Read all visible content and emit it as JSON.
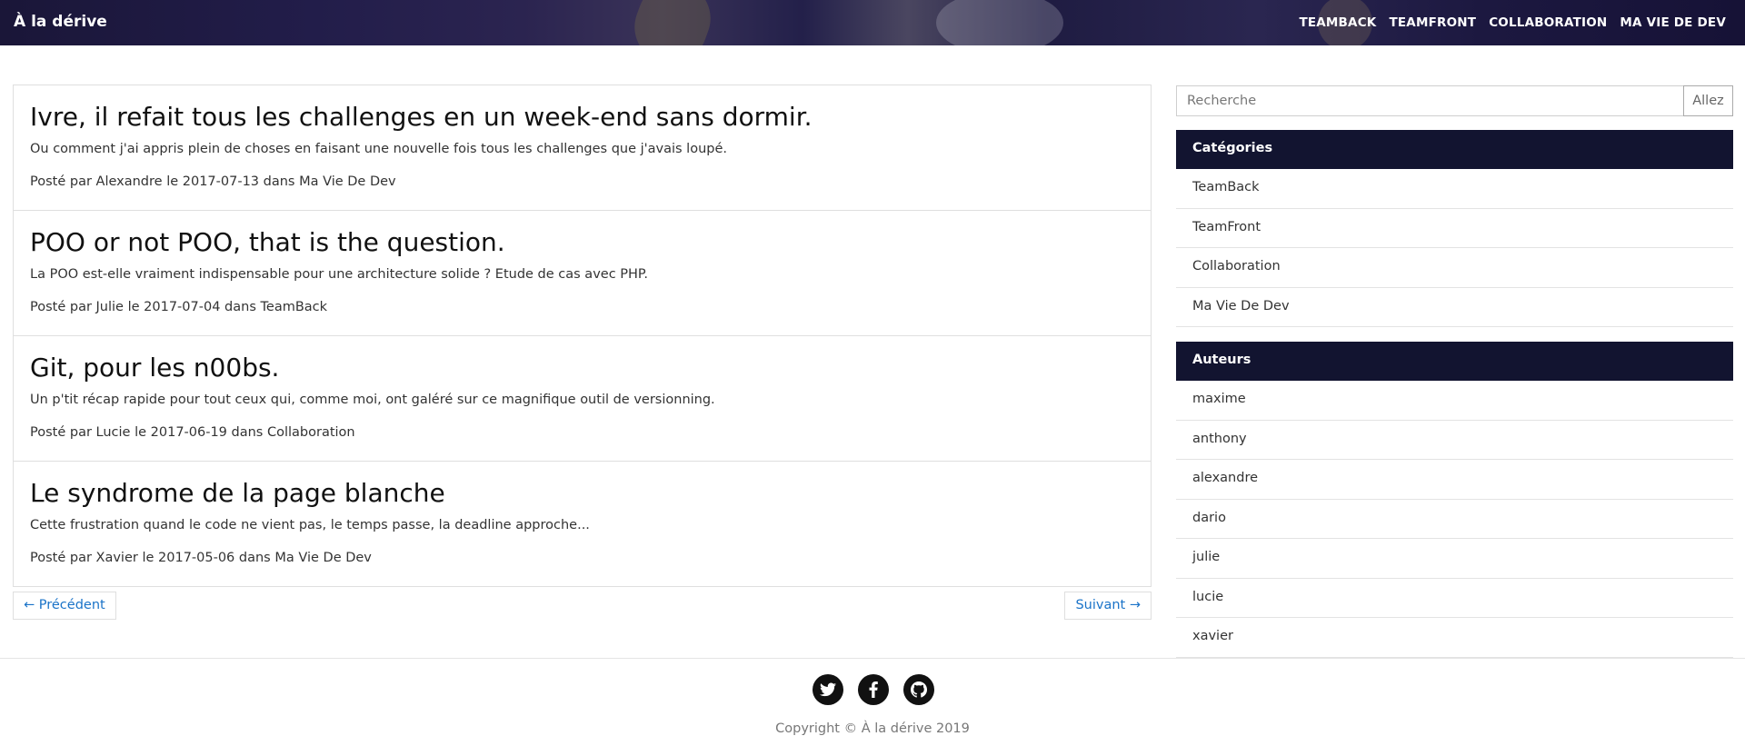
{
  "header": {
    "brand": "À la dérive",
    "nav": [
      "TEAMBACK",
      "TEAMFRONT",
      "COLLABORATION",
      "MA VIE DE DEV"
    ]
  },
  "posts": [
    {
      "title": "Ivre, il refait tous les challenges en un week-end sans dormir.",
      "excerpt": "Ou comment j'ai appris plein de choses en faisant une nouvelle fois tous les challenges que j'avais loupé.",
      "meta_prefix": "Posté par",
      "author": "Alexandre",
      "meta_le": "le",
      "date": "2017-07-13",
      "meta_dans": "dans",
      "category": "Ma Vie De Dev"
    },
    {
      "title": "POO or not POO, that is the question.",
      "excerpt": "La POO est-elle vraiment indispensable pour une architecture solide ? Etude de cas avec PHP.",
      "meta_prefix": "Posté par",
      "author": "Julie",
      "meta_le": "le",
      "date": "2017-07-04",
      "meta_dans": "dans",
      "category": "TeamBack"
    },
    {
      "title": "Git, pour les n00bs.",
      "excerpt": "Un p'tit récap rapide pour tout ceux qui, comme moi, ont galéré sur ce magnifique outil de versionning.",
      "meta_prefix": "Posté par",
      "author": "Lucie",
      "meta_le": "le",
      "date": "2017-06-19",
      "meta_dans": "dans",
      "category": "Collaboration"
    },
    {
      "title": "Le syndrome de la page blanche",
      "excerpt": "Cette frustration quand le code ne vient pas, le temps passe, la deadline approche...",
      "meta_prefix": "Posté par",
      "author": "Xavier",
      "meta_le": "le",
      "date": "2017-05-06",
      "meta_dans": "dans",
      "category": "Ma Vie De Dev"
    }
  ],
  "pager": {
    "prev": "← Précédent",
    "next": "Suivant →"
  },
  "search": {
    "placeholder": "Recherche",
    "button": "Allez"
  },
  "categories": {
    "heading": "Catégories",
    "items": [
      "TeamBack",
      "TeamFront",
      "Collaboration",
      "Ma Vie De Dev"
    ]
  },
  "authors": {
    "heading": "Auteurs",
    "items": [
      "maxime",
      "anthony",
      "alexandre",
      "dario",
      "julie",
      "lucie",
      "xavier"
    ]
  },
  "footer": {
    "socials": [
      "twitter-icon",
      "facebook-icon",
      "github-icon"
    ],
    "copyright": "Copyright © À la dérive 2019"
  }
}
